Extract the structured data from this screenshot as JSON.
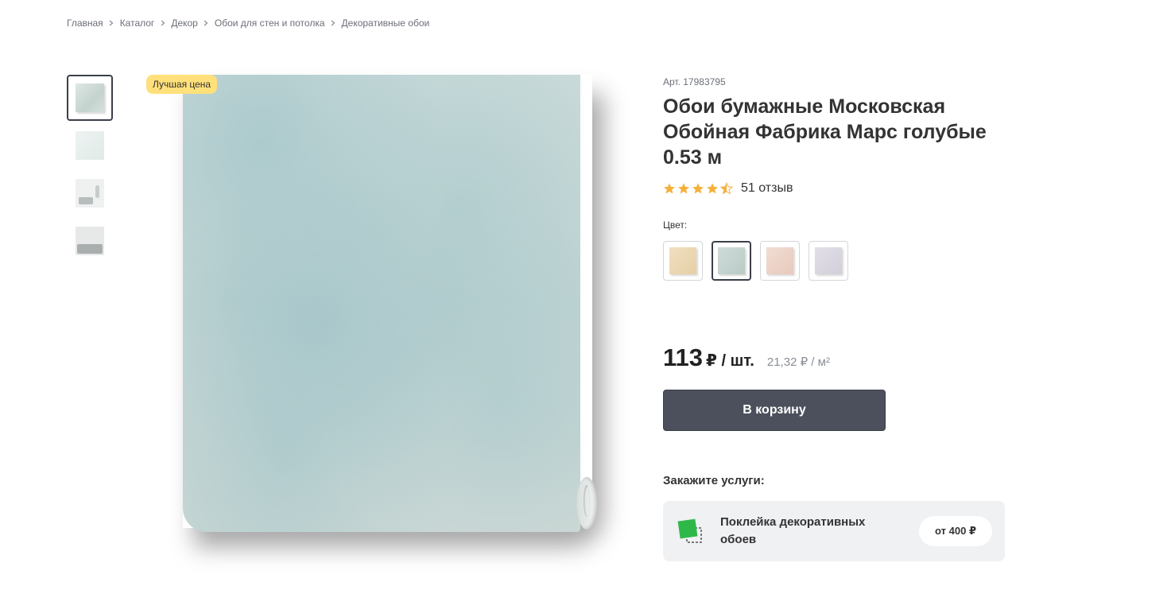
{
  "breadcrumb": [
    {
      "label": "Главная"
    },
    {
      "label": "Каталог"
    },
    {
      "label": "Декор"
    },
    {
      "label": "Обои для стен и потолка"
    },
    {
      "label": "Декоративные обои"
    }
  ],
  "gallery": {
    "badge": "Лучшая цена",
    "thumbnail_count": 4,
    "active_thumbnail": 1
  },
  "product": {
    "sku": "Арт. 17983795",
    "title": "Обои бумажные Московская Обойная Фабрика Марс голубые 0.53 м",
    "rating": 4.5,
    "reviews": "51 отзыв"
  },
  "colors": {
    "label": "Цвет:",
    "options": [
      {
        "name": "beige",
        "hex": "#e8d3ae"
      },
      {
        "name": "blue",
        "hex": "#c1d3cf",
        "selected": true
      },
      {
        "name": "pink",
        "hex": "#ebd3c8"
      },
      {
        "name": "lilac",
        "hex": "#d9d6df"
      }
    ]
  },
  "price": {
    "value": "113",
    "unit": "₽ / шт.",
    "per_m2": "21,32 ₽ / м²"
  },
  "cart_button": "В корзину",
  "services": {
    "title": "Закажите услуги:",
    "items": [
      {
        "name": "Поклейка декоративных обоев",
        "price": "от 400 ₽"
      }
    ]
  },
  "accent_colors": {
    "badge": "#ffe07a",
    "button": "#4b505c",
    "star": "#f5b13d",
    "service_icon": "#2fb84a"
  }
}
